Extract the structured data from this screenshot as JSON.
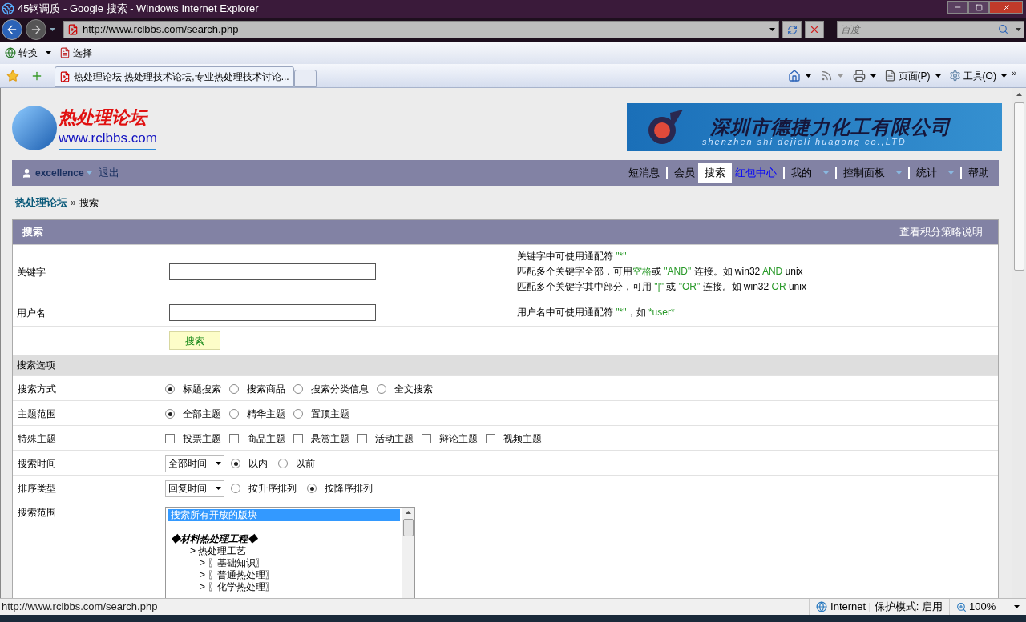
{
  "window": {
    "title": "45钢调质 - Google 搜索 - Windows Internet Explorer"
  },
  "address_bar": {
    "url": "http://www.rclbbs.com/search.php"
  },
  "search_box": {
    "placeholder": "百度"
  },
  "command_bar": {
    "items": [
      "转换",
      "选择"
    ]
  },
  "tabs": [
    {
      "label": "热处理论坛 热处理技术论坛,专业热处理技术讨论...",
      "selected": true
    }
  ],
  "toolbar": {
    "page_menu": "页面(P)",
    "tools_menu": "工具(O)",
    "overflow": "»"
  },
  "site": {
    "logo_title": "热处理论坛",
    "logo_url": "www.rclbbs.com",
    "banner_title": "深圳市德捷力化工有限公司",
    "banner_subtitle": "shenzhen shi dejieli huagong co.,LTD"
  },
  "user_bar": {
    "username": "excellence",
    "logout": "退出",
    "nav": [
      {
        "label": "短消息",
        "selected": false,
        "dropdown": false,
        "highlighted": false
      },
      {
        "label": "会员",
        "selected": false,
        "dropdown": false,
        "highlighted": false
      },
      {
        "label": "搜索",
        "selected": true,
        "dropdown": false,
        "highlighted": false
      },
      {
        "label": "红包中心",
        "selected": false,
        "dropdown": false,
        "highlighted": true
      },
      {
        "label": "我的",
        "selected": false,
        "dropdown": true,
        "highlighted": false
      },
      {
        "label": "控制面板",
        "selected": false,
        "dropdown": true,
        "highlighted": false
      },
      {
        "label": "统计",
        "selected": false,
        "dropdown": true,
        "highlighted": false
      },
      {
        "label": "帮助",
        "selected": false,
        "dropdown": false,
        "highlighted": false
      }
    ]
  },
  "breadcrumb": {
    "home": "热处理论坛",
    "separator": "»",
    "current": "搜索"
  },
  "panel": {
    "title": "搜索",
    "link": "查看积分策略说明"
  },
  "fields": [
    {
      "label": "关键字",
      "help": [
        [
          {
            "text": "关键字中可使用通配符 ",
            "highlight": false
          },
          {
            "text": "\"*\"",
            "highlight": true
          }
        ],
        [
          {
            "text": "匹配多个关键字全部，可用",
            "highlight": false
          },
          {
            "text": "空格",
            "highlight": true
          },
          {
            "text": "或 ",
            "highlight": false
          },
          {
            "text": "\"AND\"",
            "highlight": true
          },
          {
            "text": " 连接。如 win32 ",
            "highlight": false
          },
          {
            "text": "AND",
            "highlight": true
          },
          {
            "text": " unix",
            "highlight": false
          }
        ],
        [
          {
            "text": "匹配多个关键字其中部分，可用 ",
            "highlight": false
          },
          {
            "text": "\"|\"",
            "highlight": true
          },
          {
            "text": " 或 ",
            "highlight": false
          },
          {
            "text": "\"OR\"",
            "highlight": true
          },
          {
            "text": " 连接。如 win32 ",
            "highlight": false
          },
          {
            "text": "OR",
            "highlight": true
          },
          {
            "text": " unix",
            "highlight": false
          }
        ]
      ]
    },
    {
      "label": "用户名",
      "help": [
        [
          {
            "text": "用户名中可使用通配符 ",
            "highlight": false
          },
          {
            "text": "\"*\"",
            "highlight": true
          },
          {
            "text": "，如 ",
            "highlight": false
          },
          {
            "text": "*user*",
            "highlight": true
          }
        ]
      ]
    }
  ],
  "submit": "搜索",
  "options_header": "搜索选项",
  "options": [
    {
      "kind": "radio",
      "label": "搜索方式",
      "choices": [
        {
          "label": "标题搜索",
          "selected": true
        },
        {
          "label": "搜索商品",
          "selected": false
        },
        {
          "label": "搜索分类信息",
          "selected": false
        },
        {
          "label": "全文搜索",
          "selected": false
        }
      ]
    },
    {
      "kind": "radio",
      "label": "主题范围",
      "choices": [
        {
          "label": "全部主题",
          "selected": true
        },
        {
          "label": "精华主题",
          "selected": false
        },
        {
          "label": "置顶主题",
          "selected": false
        }
      ]
    },
    {
      "kind": "checkbox",
      "label": "特殊主题",
      "choices": [
        {
          "label": "投票主题",
          "checked": false
        },
        {
          "label": "商品主题",
          "checked": false
        },
        {
          "label": "悬赏主题",
          "checked": false
        },
        {
          "label": "活动主题",
          "checked": false
        },
        {
          "label": "辩论主题",
          "checked": false
        },
        {
          "label": "视频主题",
          "checked": false
        }
      ]
    },
    {
      "kind": "select_radio",
      "label": "搜索时间",
      "select": "全部时间",
      "choices": [
        {
          "label": "以内",
          "selected": true
        },
        {
          "label": "以前",
          "selected": false
        }
      ]
    },
    {
      "kind": "select_radio",
      "label": "排序类型",
      "select": "回复时间",
      "choices": [
        {
          "label": "按升序排列",
          "selected": false
        },
        {
          "label": "按降序排列",
          "selected": true
        }
      ]
    },
    {
      "kind": "listbox",
      "label": "搜索范围",
      "items": [
        {
          "kind": "option",
          "text": "搜索所有开放的版块",
          "selected": true
        },
        {
          "kind": "category",
          "text": "◆材料热处理工程◆",
          "selected": false,
          "children": [
            {
              "kind": "option",
              "text": "> 热处理工艺",
              "selected": false,
              "children": [
                {
                  "kind": "option",
                  "text": "> 〖基础知识〗",
                  "selected": false
                },
                {
                  "kind": "option",
                  "text": "> 〖普通热处理〗",
                  "selected": false
                },
                {
                  "kind": "option",
                  "text": "> 〖化学热处理〗",
                  "selected": false
                }
              ]
            }
          ]
        }
      ]
    }
  ],
  "status_bar": {
    "url": "http://www.rclbbs.com/search.php",
    "zone": "Internet | 保护模式: 启用",
    "zoom": "100%"
  }
}
